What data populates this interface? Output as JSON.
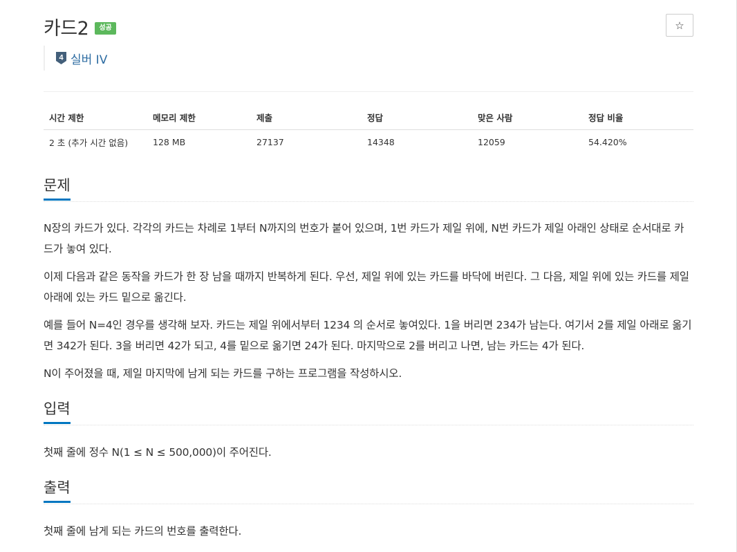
{
  "problem": {
    "title": "카드2",
    "status_badge": "성공",
    "star_icon": "☆",
    "tier": {
      "number": "4",
      "label": "실버 IV",
      "color": "#2d6ca2"
    }
  },
  "stats": {
    "headers": [
      "시간 제한",
      "메모리 제한",
      "제출",
      "정답",
      "맞은 사람",
      "정답 비율"
    ],
    "values": [
      "2 초 (추가 시간 없음)",
      "128 MB",
      "27137",
      "14348",
      "12059",
      "54.420%"
    ]
  },
  "sections": {
    "problem": {
      "heading": "문제",
      "paragraphs": [
        "N장의 카드가 있다. 각각의 카드는 차례로 1부터 N까지의 번호가 붙어 있으며, 1번 카드가 제일 위에, N번 카드가 제일 아래인 상태로 순서대로 카드가 놓여 있다.",
        "이제 다음과 같은 동작을 카드가 한 장 남을 때까지 반복하게 된다. 우선, 제일 위에 있는 카드를 바닥에 버린다. 그 다음, 제일 위에 있는 카드를 제일 아래에 있는 카드 밑으로 옮긴다.",
        "예를 들어 N=4인 경우를 생각해 보자. 카드는 제일 위에서부터 1234 의 순서로 놓여있다. 1을 버리면 234가 남는다. 여기서 2를 제일 아래로 옮기면 342가 된다. 3을 버리면 42가 되고, 4를 밑으로 옮기면 24가 된다. 마지막으로 2를 버리고 나면, 남는 카드는 4가 된다.",
        "N이 주어졌을 때, 제일 마지막에 남게 되는 카드를 구하는 프로그램을 작성하시오."
      ]
    },
    "input": {
      "heading": "입력",
      "paragraphs": [
        "첫째 줄에 정수 N(1 ≤ N ≤ 500,000)이 주어진다."
      ]
    },
    "output": {
      "heading": "출력",
      "paragraphs": [
        "첫째 줄에 남게 되는 카드의 번호를 출력한다."
      ]
    }
  },
  "colors": {
    "accent": "#0076c0",
    "success": "#5cb85c",
    "tier_silver": "#435f7a"
  }
}
